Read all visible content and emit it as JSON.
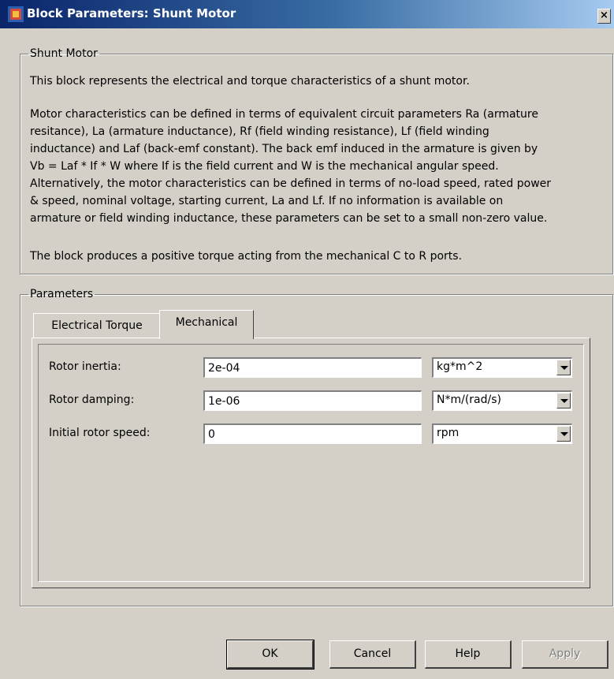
{
  "window": {
    "title": "Block Parameters: Shunt Motor",
    "close_label": "×"
  },
  "description": {
    "group_label": "Shunt Motor",
    "paragraph1": "This block represents the electrical and torque characteristics of a shunt motor.",
    "paragraph2_lines": [
      "Motor characteristics can be defined in terms of equivalent circuit parameters Ra (armature",
      "resitance), La (armature inductance), Rf (field winding resistance), Lf (field winding",
      "inductance) and Laf (back-emf constant). The back emf induced in the armature is given by",
      "Vb = Laf * If * W where If is the field current and W is the mechanical angular speed.",
      "Alternatively, the motor characteristics can be defined in terms of no-load speed, rated power",
      "& speed, nominal voltage, starting current, La and Lf. If no information is available on",
      "armature or field winding inductance, these parameters can be set to a small non-zero value."
    ],
    "paragraph3": "The block produces a positive torque acting from the mechanical C to R ports."
  },
  "parameters": {
    "group_label": "Parameters",
    "tabs": [
      {
        "label": "Electrical Torque",
        "active": false
      },
      {
        "label": "Mechanical",
        "active": true
      }
    ],
    "rows": [
      {
        "label": "Rotor inertia:",
        "value": "2e-04",
        "unit": "kg*m^2"
      },
      {
        "label": "Rotor damping:",
        "value": "1e-06",
        "unit": "N*m/(rad/s)"
      },
      {
        "label": "Initial rotor speed:",
        "value": "0",
        "unit": "rpm"
      }
    ]
  },
  "buttons": {
    "ok": "OK",
    "cancel": "Cancel",
    "help": "Help",
    "apply": "Apply"
  }
}
